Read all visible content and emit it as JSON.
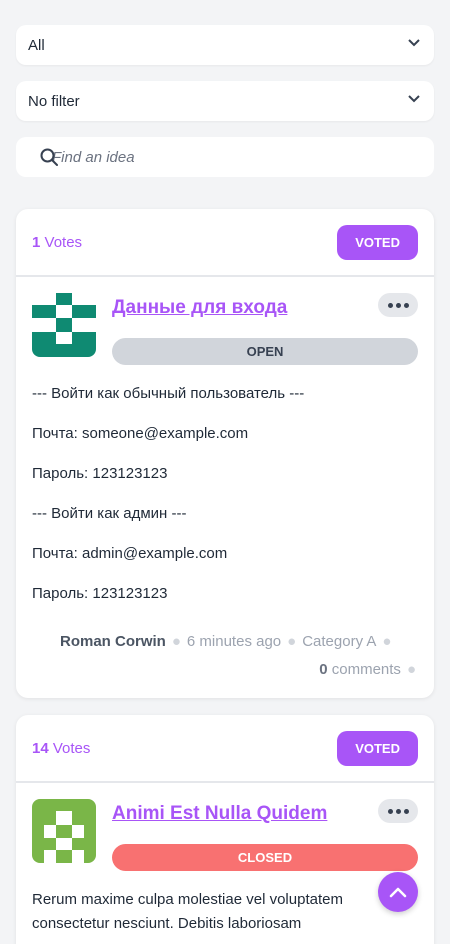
{
  "filters": {
    "category_select": "All",
    "status_select": "No filter",
    "search_placeholder": "Find an idea"
  },
  "ideas": [
    {
      "votes_count": "1",
      "votes_label": "Votes",
      "voted_label": "VOTED",
      "title": "Данные для входа",
      "status": "OPEN",
      "body": [
        "--- Войти как обычный пользователь ---",
        "Почта: someone@example.com",
        "Пароль: 123123123",
        "--- Войти как админ ---",
        "Почта: admin@example.com",
        "Пароль: 123123123"
      ],
      "author": "Roman Corwin",
      "time": "6 minutes ago",
      "category": "Category A",
      "comments_count": "0",
      "comments_label": "comments",
      "logo_color": "#0f8a72"
    },
    {
      "votes_count": "14",
      "votes_label": "Votes",
      "voted_label": "VOTED",
      "title": "Animi Est Nulla Quidem",
      "status": "CLOSED",
      "body": [
        "Rerum maxime culpa molestiae vel voluptatem",
        "consectetur nesciunt. Debitis laboriosam"
      ],
      "logo_color": "#7ab648"
    }
  ],
  "colors": {
    "accent": "#a855f7",
    "open_status": "#d1d5db",
    "closed_status": "#f87171"
  }
}
